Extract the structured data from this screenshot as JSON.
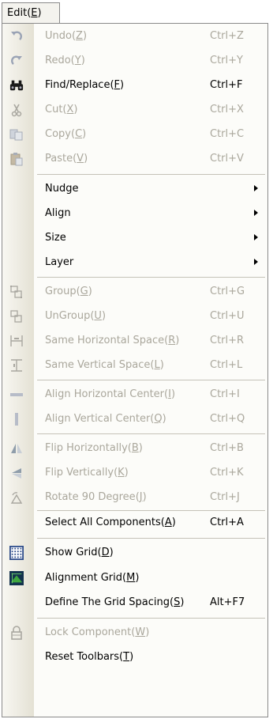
{
  "menu": {
    "title": "Edit",
    "title_mnemonic": "E",
    "items": [
      {
        "name": "undo",
        "label": "Undo",
        "key": "Z",
        "shortcut": "Ctrl+Z",
        "enabled": false,
        "icon": "undo-icon"
      },
      {
        "name": "redo",
        "label": "Redo",
        "key": "Y",
        "shortcut": "Ctrl+Y",
        "enabled": false,
        "icon": "redo-icon"
      },
      {
        "name": "find-replace",
        "label": "Find/Replace",
        "key": "F",
        "shortcut": "Ctrl+F",
        "enabled": true,
        "icon": "binoculars-icon"
      },
      {
        "name": "cut",
        "label": "Cut",
        "key": "X",
        "shortcut": "Ctrl+X",
        "enabled": false,
        "icon": "scissors-icon"
      },
      {
        "name": "copy",
        "label": "Copy",
        "key": "C",
        "shortcut": "Ctrl+C",
        "enabled": false,
        "icon": "copy-icon"
      },
      {
        "name": "paste",
        "label": "Paste",
        "key": "V",
        "shortcut": "Ctrl+V",
        "enabled": false,
        "icon": "paste-icon"
      },
      {
        "name": "nudge",
        "label": "Nudge",
        "key": "",
        "shortcut": "",
        "enabled": true,
        "submenu": true,
        "icon": ""
      },
      {
        "name": "align",
        "label": "Align",
        "key": "",
        "shortcut": "",
        "enabled": true,
        "submenu": true,
        "icon": ""
      },
      {
        "name": "size",
        "label": "Size",
        "key": "",
        "shortcut": "",
        "enabled": true,
        "submenu": true,
        "icon": ""
      },
      {
        "name": "layer",
        "label": "Layer",
        "key": "",
        "shortcut": "",
        "enabled": true,
        "submenu": true,
        "icon": ""
      },
      {
        "name": "group",
        "label": "Group",
        "key": "G",
        "shortcut": "Ctrl+G",
        "enabled": false,
        "icon": "group-icon"
      },
      {
        "name": "ungroup",
        "label": "UnGroup",
        "key": "U",
        "shortcut": "Ctrl+U",
        "enabled": false,
        "icon": "ungroup-icon"
      },
      {
        "name": "same-horizontal-space",
        "label": "Same Horizontal Space",
        "key": "R",
        "shortcut": "Ctrl+R",
        "enabled": false,
        "icon": "horizontal-space-icon"
      },
      {
        "name": "same-vertical-space",
        "label": "Same Vertical Space",
        "key": "L",
        "shortcut": "Ctrl+L",
        "enabled": false,
        "icon": "vertical-space-icon"
      },
      {
        "name": "align-horizontal-center",
        "label": "Align Horizontal Center",
        "key": "I",
        "shortcut": "Ctrl+I",
        "enabled": false,
        "icon": "align-horizontal-center-icon"
      },
      {
        "name": "align-vertical-center",
        "label": "Align Vertical Center",
        "key": "Q",
        "shortcut": "Ctrl+Q",
        "enabled": false,
        "icon": "align-vertical-center-icon"
      },
      {
        "name": "flip-horizontally",
        "label": "Flip Horizontally",
        "key": "B",
        "shortcut": "Ctrl+B",
        "enabled": false,
        "icon": "flip-horizontal-icon"
      },
      {
        "name": "flip-vertically",
        "label": "Flip Vertically",
        "key": "K",
        "shortcut": "Ctrl+K",
        "enabled": false,
        "icon": "flip-vertical-icon"
      },
      {
        "name": "rotate-90",
        "label": "Rotate 90 Degree",
        "key": "J",
        "shortcut": "Ctrl+J",
        "enabled": false,
        "icon": "rotate-icon"
      },
      {
        "name": "select-all-components",
        "label": "Select All Components",
        "key": "A",
        "shortcut": "Ctrl+A",
        "enabled": true,
        "icon": ""
      },
      {
        "name": "show-grid",
        "label": "Show Grid",
        "key": "D",
        "shortcut": "",
        "enabled": true,
        "icon": "grid-icon"
      },
      {
        "name": "alignment-grid",
        "label": "Alignment Grid",
        "key": "M",
        "shortcut": "",
        "enabled": true,
        "icon": "alignment-grid-icon"
      },
      {
        "name": "define-grid-spacing",
        "label": "Define The Grid Spacing",
        "key": "S",
        "shortcut": "Alt+F7",
        "enabled": true,
        "icon": ""
      },
      {
        "name": "lock-component",
        "label": "Lock Component",
        "key": "W",
        "shortcut": "",
        "enabled": false,
        "icon": "lock-icon"
      },
      {
        "name": "reset-toolbars",
        "label": "Reset Toolbars",
        "key": "T",
        "shortcut": "",
        "enabled": true,
        "icon": ""
      }
    ]
  },
  "colors": {
    "disabled_text": "#aaa79c",
    "gutter": "#e4e1d4",
    "separator": "#c5c2b8",
    "border": "#8a8a8a"
  }
}
